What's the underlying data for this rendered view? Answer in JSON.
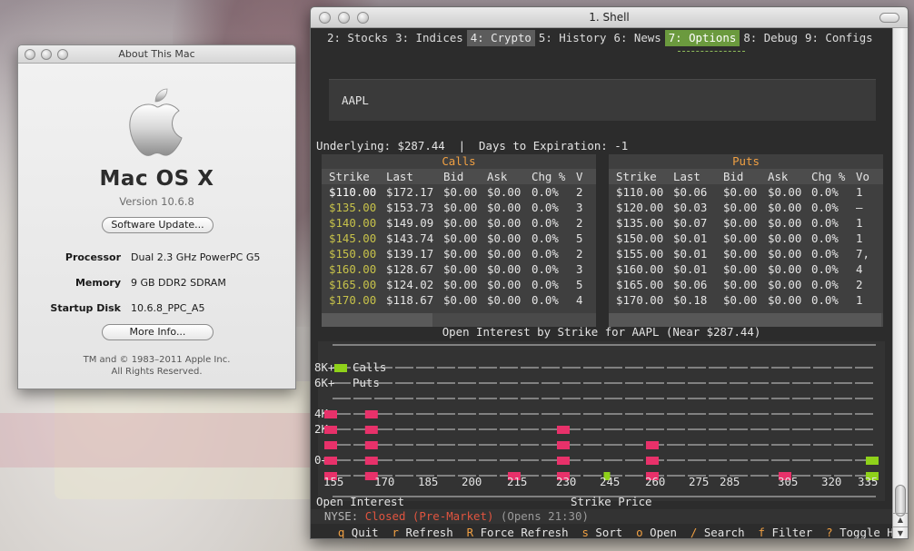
{
  "about": {
    "title": "About This Mac",
    "os_name": "Mac OS X",
    "version": "Version 10.6.8",
    "software_update": "Software Update...",
    "specs": [
      {
        "key": "Processor",
        "value": "Dual 2.3 GHz PowerPC G5"
      },
      {
        "key": "Memory",
        "value": "9 GB DDR2 SDRAM"
      },
      {
        "key": "Startup Disk",
        "value": "10.6.8_PPC_A5"
      }
    ],
    "more_info": "More Info...",
    "copyright_1": "TM and © 1983–2011 Apple Inc.",
    "copyright_2": "All Rights Reserved."
  },
  "shell": {
    "title": "1. Shell",
    "tabs": [
      {
        "label": "2: Stocks"
      },
      {
        "label": "3: Indices"
      },
      {
        "label": "4: Crypto"
      },
      {
        "label": "5: History"
      },
      {
        "label": "6: News"
      },
      {
        "label": "7: Options"
      },
      {
        "label": "8: Debug"
      },
      {
        "label": "9: Configs"
      }
    ],
    "symbol": "AAPL",
    "underlying": "Underlying: $287.44  |  Days to Expiration: -1",
    "calls": {
      "title": "Calls",
      "headers": [
        "Strike",
        "Last",
        "Bid",
        "Ask",
        "Chg %",
        "V"
      ],
      "rows": [
        [
          "$110.00",
          "$172.17",
          "$0.00",
          "$0.00",
          "0.0%",
          "2"
        ],
        [
          "$135.00",
          "$153.73",
          "$0.00",
          "$0.00",
          "0.0%",
          "3"
        ],
        [
          "$140.00",
          "$149.09",
          "$0.00",
          "$0.00",
          "0.0%",
          "2"
        ],
        [
          "$145.00",
          "$143.74",
          "$0.00",
          "$0.00",
          "0.0%",
          "5"
        ],
        [
          "$150.00",
          "$139.17",
          "$0.00",
          "$0.00",
          "0.0%",
          "2"
        ],
        [
          "$160.00",
          "$128.67",
          "$0.00",
          "$0.00",
          "0.0%",
          "3"
        ],
        [
          "$165.00",
          "$124.02",
          "$0.00",
          "$0.00",
          "0.0%",
          "5"
        ],
        [
          "$170.00",
          "$118.67",
          "$0.00",
          "$0.00",
          "0.0%",
          "4"
        ]
      ]
    },
    "puts": {
      "title": "Puts",
      "headers": [
        "Strike",
        "Last",
        "Bid",
        "Ask",
        "Chg %",
        "Vo"
      ],
      "rows": [
        [
          "$110.00",
          "$0.06",
          "$0.00",
          "$0.00",
          "0.0%",
          "1"
        ],
        [
          "$120.00",
          "$0.03",
          "$0.00",
          "$0.00",
          "0.0%",
          "–"
        ],
        [
          "$135.00",
          "$0.07",
          "$0.00",
          "$0.00",
          "0.0%",
          "1"
        ],
        [
          "$150.00",
          "$0.01",
          "$0.00",
          "$0.00",
          "0.0%",
          "1"
        ],
        [
          "$155.00",
          "$0.01",
          "$0.00",
          "$0.00",
          "0.0%",
          "7,"
        ],
        [
          "$160.00",
          "$0.01",
          "$0.00",
          "$0.00",
          "0.0%",
          "4"
        ],
        [
          "$165.00",
          "$0.06",
          "$0.00",
          "$0.00",
          "0.0%",
          "2"
        ],
        [
          "$170.00",
          "$0.18",
          "$0.00",
          "$0.00",
          "0.0%",
          "1"
        ]
      ]
    },
    "chart_data": {
      "type": "bar",
      "title": "Open Interest by Strike for AAPL (Near $287.44)",
      "xlabel": "Strike Price",
      "ylabel": "Open Interest",
      "y_ticks": [
        "8K+",
        "6K+",
        "4K+",
        "2K+",
        "0+"
      ],
      "x_ticks": [
        "155",
        "170",
        "185",
        "200",
        "215",
        "230",
        "245",
        "260",
        "275",
        "285",
        "305",
        "320",
        "335"
      ],
      "legend": [
        {
          "label": "Calls",
          "color": "#8fd11a"
        },
        {
          "label": "Puts",
          "color": "#e8316a"
        }
      ],
      "series": [
        {
          "name": "Calls",
          "bars": [
            {
              "strike": 245,
              "level": 0
            },
            {
              "strike": 335,
              "level": 1
            }
          ]
        },
        {
          "name": "Puts",
          "bars": [
            {
              "strike": 155,
              "level": 4
            },
            {
              "strike": 167,
              "level": 4
            },
            {
              "strike": 215,
              "level": 0
            },
            {
              "strike": 230,
              "level": 3
            },
            {
              "strike": 260,
              "level": 2
            },
            {
              "strike": 305,
              "level": 0
            }
          ]
        }
      ]
    },
    "status_market": "NYSE:",
    "status_closed": "Closed (Pre-Market)",
    "status_opens": "(Opens 21:30)",
    "shortcuts": [
      {
        "key": "q",
        "label": "Quit"
      },
      {
        "key": "r",
        "label": "Refresh"
      },
      {
        "key": "R",
        "label": "Force Refresh"
      },
      {
        "key": "s",
        "label": "Sort"
      },
      {
        "key": "o",
        "label": "Open"
      },
      {
        "key": "/",
        "label": "Search"
      },
      {
        "key": "f",
        "label": "Filter"
      },
      {
        "key": "?",
        "label": "Toggle Help"
      }
    ],
    "colors": {
      "accent_green": "#6b9a3e",
      "orange": "#f0a043",
      "calls": "#8fd11a",
      "puts": "#e8316a",
      "strike_yellow": "#c7c24a"
    }
  }
}
